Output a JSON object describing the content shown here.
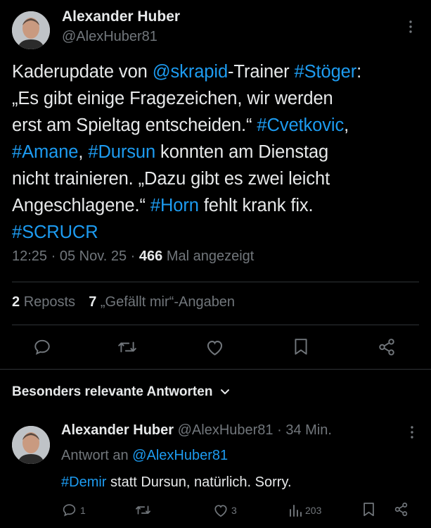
{
  "post": {
    "author_name": "Alexander Huber",
    "author_handle": "@AlexHuber81",
    "text_lines": [
      [
        {
          "t": "Kaderupdate von ",
          "k": "text"
        },
        {
          "t": "@skrapid",
          "k": "link"
        },
        {
          "t": "-Trainer ",
          "k": "text"
        },
        {
          "t": "#Stöger",
          "k": "link"
        },
        {
          "t": ":",
          "k": "text"
        }
      ],
      [
        {
          "t": "„Es gibt einige Fragezeichen, wir werden",
          "k": "text"
        }
      ],
      [
        {
          "t": "erst am Spieltag entscheiden.“ ",
          "k": "text"
        },
        {
          "t": "#Cvetkovic",
          "k": "link"
        },
        {
          "t": ",",
          "k": "text"
        }
      ],
      [
        {
          "t": "#Amane",
          "k": "link"
        },
        {
          "t": ", ",
          "k": "text"
        },
        {
          "t": "#Dursun",
          "k": "link"
        },
        {
          "t": " konnten am Dienstag",
          "k": "text"
        }
      ],
      [
        {
          "t": "nicht trainieren. „Dazu gibt es zwei leicht",
          "k": "text"
        }
      ],
      [
        {
          "t": "Angeschlagene.“ ",
          "k": "text"
        },
        {
          "t": "#Horn",
          "k": "link"
        },
        {
          "t": " fehlt krank fix.",
          "k": "text"
        }
      ],
      [
        {
          "t": "#SCRUCR",
          "k": "link"
        }
      ]
    ],
    "time": "12:25",
    "sep": "·",
    "date": "05 Nov. 25",
    "views_count": "466",
    "views_label": "Mal angezeigt",
    "reposts_count": "2",
    "reposts_label": "Reposts",
    "likes_count": "7",
    "likes_label": "„Gefällt mir“-Angaben"
  },
  "section_title": "Besonders relevante Antworten",
  "reply": {
    "author_name": "Alexander Huber",
    "author_handle": "@AlexHuber81",
    "sep": "·",
    "age": "34 Min.",
    "reply_to_label": "Antwort an",
    "reply_to_handle": "@AlexHuber81",
    "text_parts": [
      {
        "t": "#Demir",
        "k": "link"
      },
      {
        "t": " statt Dursun, natürlich. Sorry.",
        "k": "text"
      }
    ],
    "reply_count": "1",
    "like_count": "3",
    "view_count": "203"
  },
  "colors": {
    "link": "#1d9bf0",
    "muted": "#71767b",
    "divider": "#2f3336",
    "background": "#000000",
    "text": "#e7e9ea"
  },
  "icons": [
    "more-icon",
    "reply-icon",
    "repost-icon",
    "like-icon",
    "bookmark-icon",
    "share-icon",
    "chevron-down-icon",
    "views-icon"
  ]
}
